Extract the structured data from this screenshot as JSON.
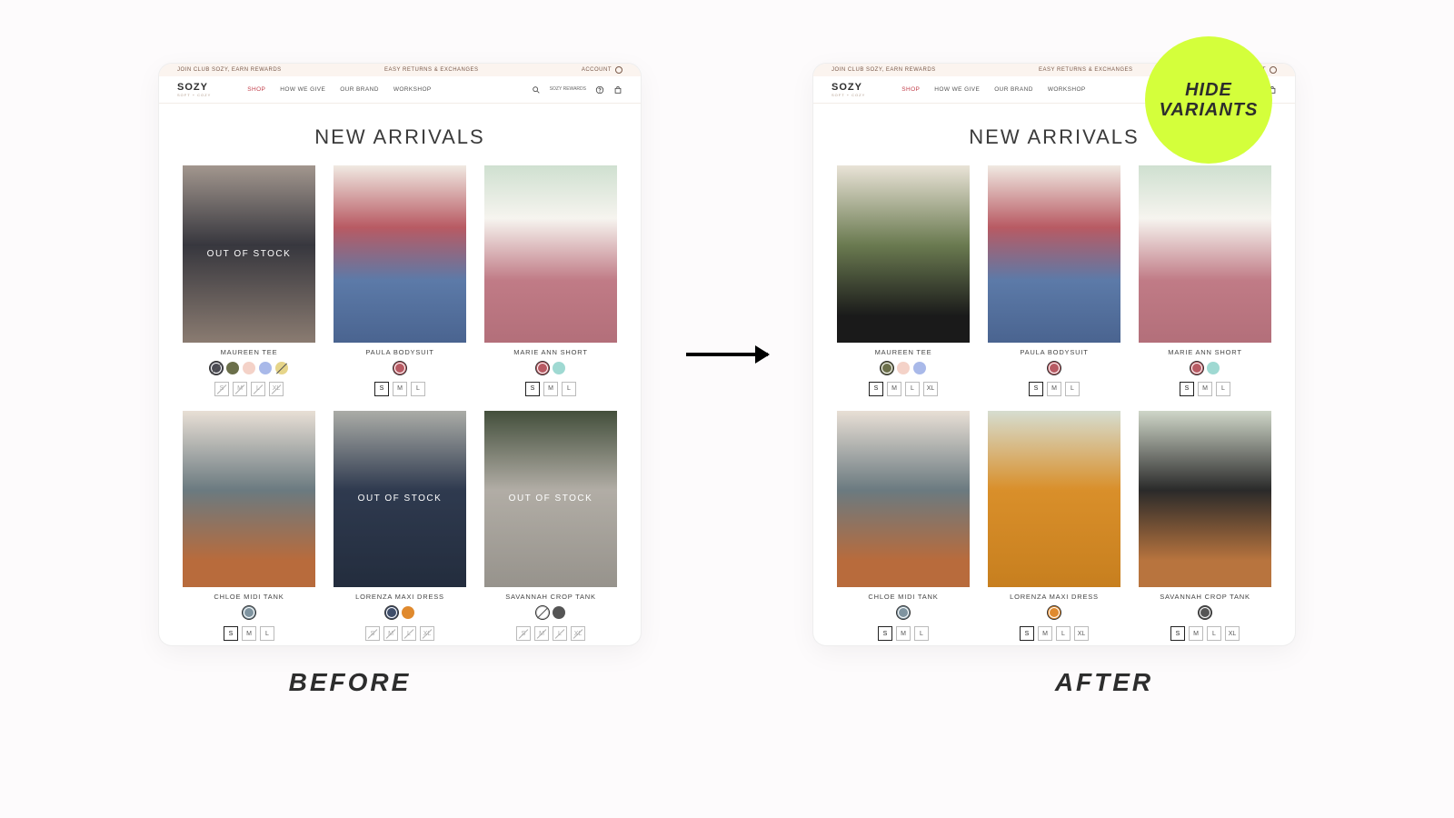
{
  "badge": {
    "line1": "HIDE",
    "line2": "VARIANTS"
  },
  "captions": {
    "before": "BEFORE",
    "after": "AFTER"
  },
  "topbar": {
    "left": "JOIN CLUB SOZY, EARN REWARDS",
    "center": "EASY RETURNS & EXCHANGES",
    "right": "ACCOUNT"
  },
  "nav": {
    "logo": "SOZY",
    "logo_tagline": "SOFT + COZY",
    "links": [
      {
        "label": "SHOP",
        "accent": true
      },
      {
        "label": "HOW WE GIVE"
      },
      {
        "label": "OUR BRAND"
      },
      {
        "label": "WORKSHOP"
      }
    ],
    "rewards": "SOZY REWARDS"
  },
  "page_title": "NEW ARRIVALS",
  "oos_label": "OUT OF STOCK",
  "colors": {
    "charcoal": "#4a4a53",
    "olive": "#6b6f4a",
    "blush": "#f4d2c8",
    "periwinkle": "#a9b9e9",
    "gold": "#e6d58a",
    "mauve": "#b85a63",
    "aqua": "#9fd9d2",
    "steel": "#7f94a0",
    "navy": "#3f4e6a",
    "amber": "#e08a2e",
    "white": "#ffffff",
    "darkgrey": "#555"
  },
  "before": {
    "products": [
      {
        "name": "MAUREEN TEE",
        "photo": "ph-a",
        "oos": true,
        "swatches": [
          {
            "c": "charcoal",
            "selected": true,
            "strike": true
          },
          {
            "c": "olive"
          },
          {
            "c": "blush"
          },
          {
            "c": "periwinkle"
          },
          {
            "c": "gold",
            "strike": true
          }
        ],
        "sizes": [
          {
            "label": "S",
            "strike": true
          },
          {
            "label": "M",
            "strike": true
          },
          {
            "label": "L",
            "strike": true
          },
          {
            "label": "XL",
            "strike": true
          }
        ]
      },
      {
        "name": "PAULA BODYSUIT",
        "photo": "ph-b",
        "swatches": [
          {
            "c": "mauve",
            "selected": true
          }
        ],
        "sizes": [
          {
            "label": "S",
            "selected": true
          },
          {
            "label": "M"
          },
          {
            "label": "L"
          }
        ]
      },
      {
        "name": "MARIE ANN SHORT",
        "photo": "ph-c",
        "swatches": [
          {
            "c": "mauve",
            "selected": true
          },
          {
            "c": "aqua"
          }
        ],
        "sizes": [
          {
            "label": "S",
            "selected": true
          },
          {
            "label": "M"
          },
          {
            "label": "L"
          }
        ]
      },
      {
        "name": "CHLOE MIDI TANK",
        "photo": "ph-d",
        "swatches": [
          {
            "c": "steel",
            "selected": true
          }
        ],
        "sizes": [
          {
            "label": "S",
            "selected": true
          },
          {
            "label": "M"
          },
          {
            "label": "L"
          }
        ]
      },
      {
        "name": "LORENZA MAXI DRESS",
        "photo": "ph-e",
        "oos": true,
        "swatches": [
          {
            "c": "navy",
            "selected": true
          },
          {
            "c": "amber"
          }
        ],
        "sizes": [
          {
            "label": "S",
            "strike": true
          },
          {
            "label": "M",
            "strike": true
          },
          {
            "label": "L",
            "strike": true
          },
          {
            "label": "XL",
            "strike": true
          }
        ]
      },
      {
        "name": "SAVANNAH CROP TANK",
        "photo": "ph-f",
        "oos": true,
        "swatches": [
          {
            "c": "white",
            "selected": true,
            "strike": true
          },
          {
            "c": "darkgrey"
          }
        ],
        "sizes": [
          {
            "label": "S",
            "strike": true
          },
          {
            "label": "M",
            "strike": true
          },
          {
            "label": "L",
            "strike": true
          },
          {
            "label": "XL",
            "strike": true
          }
        ]
      }
    ]
  },
  "after": {
    "products": [
      {
        "name": "MAUREEN TEE",
        "photo": "ph-g",
        "swatches": [
          {
            "c": "olive",
            "selected": true
          },
          {
            "c": "blush"
          },
          {
            "c": "periwinkle"
          }
        ],
        "sizes": [
          {
            "label": "S",
            "selected": true
          },
          {
            "label": "M"
          },
          {
            "label": "L"
          },
          {
            "label": "XL"
          }
        ]
      },
      {
        "name": "PAULA BODYSUIT",
        "photo": "ph-b",
        "swatches": [
          {
            "c": "mauve",
            "selected": true
          }
        ],
        "sizes": [
          {
            "label": "S",
            "selected": true
          },
          {
            "label": "M"
          },
          {
            "label": "L"
          }
        ]
      },
      {
        "name": "MARIE ANN SHORT",
        "photo": "ph-c",
        "swatches": [
          {
            "c": "mauve",
            "selected": true
          },
          {
            "c": "aqua"
          }
        ],
        "sizes": [
          {
            "label": "S",
            "selected": true
          },
          {
            "label": "M"
          },
          {
            "label": "L"
          }
        ]
      },
      {
        "name": "CHLOE MIDI TANK",
        "photo": "ph-d",
        "swatches": [
          {
            "c": "steel",
            "selected": true
          }
        ],
        "sizes": [
          {
            "label": "S",
            "selected": true
          },
          {
            "label": "M"
          },
          {
            "label": "L"
          }
        ]
      },
      {
        "name": "LORENZA MAXI DRESS",
        "photo": "ph-h",
        "swatches": [
          {
            "c": "amber",
            "selected": true
          }
        ],
        "sizes": [
          {
            "label": "S",
            "selected": true
          },
          {
            "label": "M"
          },
          {
            "label": "L"
          },
          {
            "label": "XL"
          }
        ]
      },
      {
        "name": "SAVANNAH CROP TANK",
        "photo": "ph-i",
        "swatches": [
          {
            "c": "darkgrey",
            "selected": true
          }
        ],
        "sizes": [
          {
            "label": "S",
            "selected": true
          },
          {
            "label": "M"
          },
          {
            "label": "L"
          },
          {
            "label": "XL"
          }
        ]
      }
    ]
  }
}
